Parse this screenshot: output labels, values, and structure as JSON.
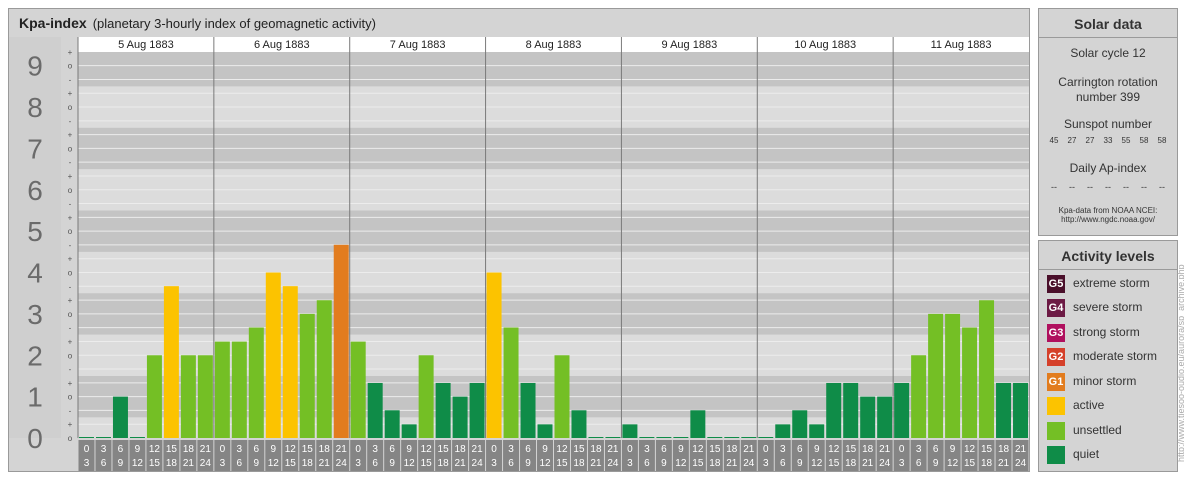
{
  "chart_data": {
    "type": "bar",
    "title": "Kpa-index",
    "subtitle": "(planetary 3-hourly index of geomagnetic activity)",
    "days": [
      "5 Aug 1883",
      "6 Aug 1883",
      "7 Aug 1883",
      "8 Aug 1883",
      "9 Aug 1883",
      "10 Aug 1883",
      "11 Aug 1883"
    ],
    "interval_starts": [
      "0",
      "3",
      "6",
      "9",
      "12",
      "15",
      "18",
      "21"
    ],
    "interval_ends": [
      "3",
      "6",
      "9",
      "12",
      "15",
      "18",
      "21",
      "24"
    ],
    "y_ticks": [
      "0",
      "1",
      "2",
      "3",
      "4",
      "5",
      "6",
      "7",
      "8",
      "9"
    ],
    "y_minor_labels": [
      "+",
      "o",
      "-"
    ],
    "ylim": [
      0,
      9.33
    ],
    "values": [
      0,
      0,
      1,
      0,
      2,
      3.67,
      2,
      2,
      2.33,
      2.33,
      2.67,
      4,
      3.67,
      3,
      3.33,
      4.67,
      2.33,
      1.33,
      0.67,
      0.33,
      2,
      1.33,
      1,
      1.33,
      4,
      2.67,
      1.33,
      0.33,
      2,
      0.67,
      0,
      0,
      0.33,
      0,
      0,
      0,
      0.67,
      0,
      0,
      0,
      0,
      0.33,
      0.67,
      0.33,
      1.33,
      1.33,
      1,
      1,
      1.33,
      2,
      3,
      3,
      2.67,
      3.33,
      1.33,
      1.33
    ],
    "color_quiet": "#0f8c48",
    "color_unsettled": "#74bf25",
    "color_active": "#fcc300",
    "color_minor": "#e27c1e",
    "grid": true
  },
  "solar_panel": {
    "title": "Solar data",
    "cycle": "Solar cycle 12",
    "rotation": "Carrington rotation number 399",
    "sunspot_title": "Sunspot number",
    "sunspot_values": [
      "45",
      "27",
      "27",
      "33",
      "55",
      "58",
      "58"
    ],
    "ap_title": "Daily Ap-index",
    "ap_values": [
      "--",
      "--",
      "--",
      "--",
      "--",
      "--",
      "--"
    ],
    "source_line1": "Kpa-data from NOAA NCEI:",
    "source_line2": "http://www.ngdc.noaa.gov/"
  },
  "activity_panel": {
    "title": "Activity levels",
    "levels": [
      {
        "badge": "G5",
        "label": "extreme storm",
        "color": "#4a0f2a"
      },
      {
        "badge": "G4",
        "label": "severe storm",
        "color": "#6c1a44"
      },
      {
        "badge": "G3",
        "label": "strong storm",
        "color": "#b0105e"
      },
      {
        "badge": "G2",
        "label": "moderate storm",
        "color": "#d5402a"
      },
      {
        "badge": "G1",
        "label": "minor storm",
        "color": "#e27c1e"
      },
      {
        "badge": "",
        "label": "active",
        "color": "#fcc300"
      },
      {
        "badge": "",
        "label": "unsettled",
        "color": "#74bf25"
      },
      {
        "badge": "",
        "label": "quiet",
        "color": "#0f8c48"
      }
    ]
  },
  "watermark": "http://www.tiesoo-oudio.eu/aurora/sp_archive.php"
}
